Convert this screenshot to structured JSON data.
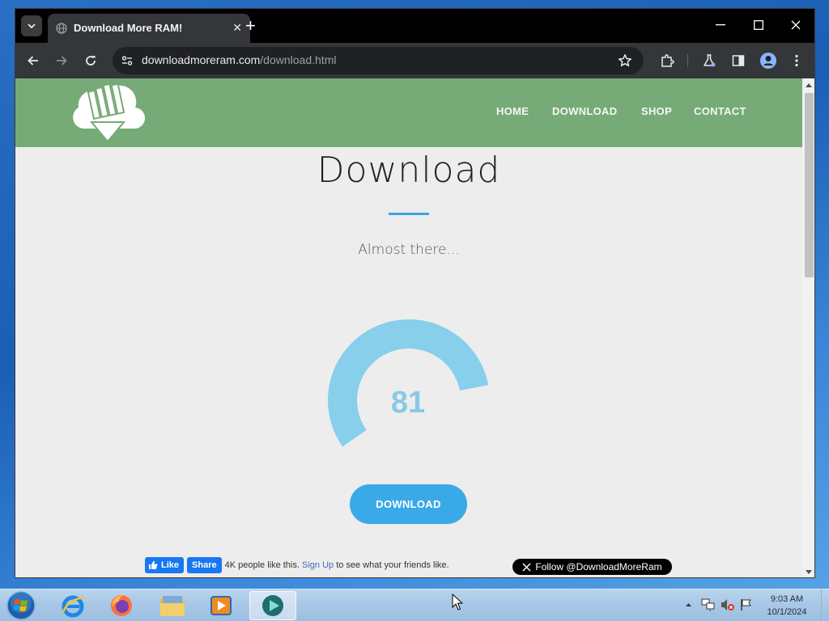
{
  "browser": {
    "tab_title": "Download More RAM!",
    "new_tab_label": "+",
    "url_domain": "downloadmoreram.com",
    "url_path": "/download.html"
  },
  "site": {
    "nav": [
      "HOME",
      "DOWNLOAD",
      "SHOP",
      "CONTACT"
    ],
    "header_color": "#76ab77"
  },
  "main": {
    "title": "Download",
    "subtitle": "Almost there...",
    "progress_value": "81",
    "progress_fraction": 0.81,
    "download_button": "DOWNLOAD",
    "accent_color": "#3aa9e8"
  },
  "social": {
    "fb_like": "Like",
    "fb_share": "Share",
    "fb_count": "4K people like this.",
    "fb_signup": "Sign Up",
    "fb_suffix": "to see what your friends like.",
    "x_follow": "Follow @DownloadMoreRam"
  },
  "taskbar": {
    "apps": [
      "internet-explorer-icon",
      "firefox-icon",
      "file-explorer-icon",
      "media-player-icon",
      "active-app-icon"
    ],
    "time": "9:03 AM",
    "date": "10/1/2024"
  }
}
